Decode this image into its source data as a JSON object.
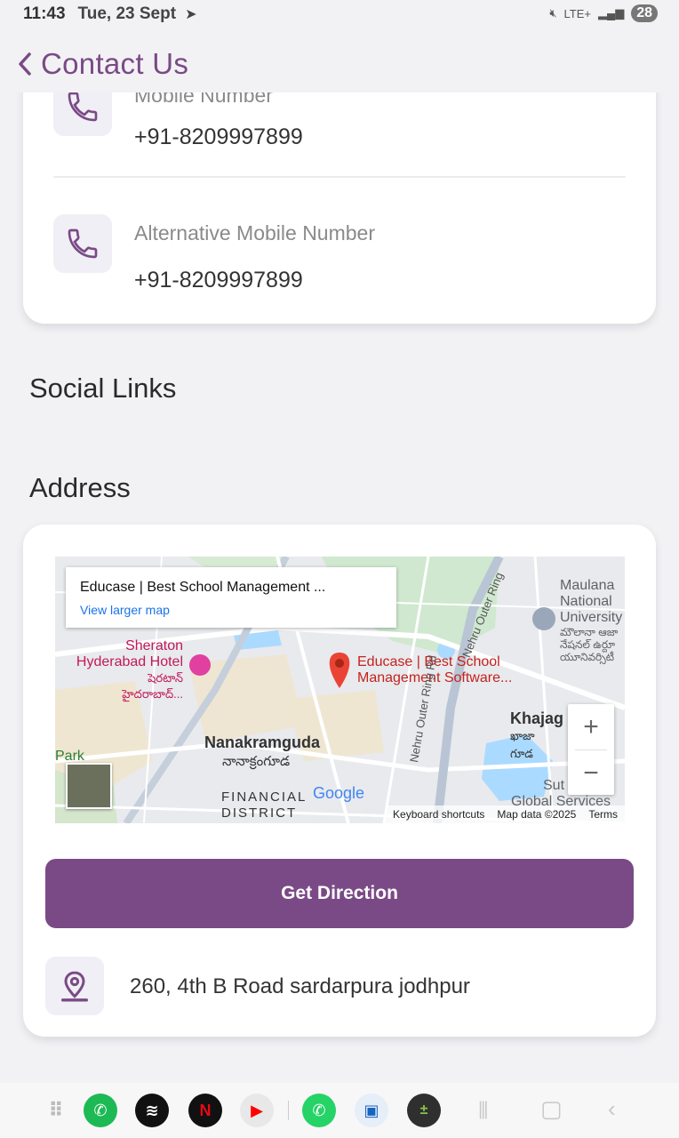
{
  "status_bar": {
    "time": "11:43",
    "date": "Tue, 23 Sept",
    "network": "LTE+",
    "battery": "28"
  },
  "header": {
    "title": "Contact Us"
  },
  "contacts": [
    {
      "label": "Mobile Number",
      "value": "+91-8209997899",
      "icon": "phone-icon"
    },
    {
      "label": "Alternative Mobile Number",
      "value": "+91-8209997899",
      "icon": "phone-icon"
    }
  ],
  "sections": {
    "social_links": "Social Links",
    "address": "Address"
  },
  "map": {
    "info_title": "Educase | Best School Management ...",
    "info_link": "View larger map",
    "pin_label_line1": "Educase | Best School",
    "pin_label_line2": "Management Software...",
    "place_sheraton_1": "Sheraton",
    "place_sheraton_2": "Hyderabad Hotel",
    "place_sheraton_te": "షెరటాన్ హైదరాబాద్...",
    "place_nanakramguda": "Nanakramguda",
    "place_nanakramguda_te": "నానాక్రంగూడ",
    "place_financial_1": "FINANCIAL",
    "place_financial_2": "DISTRICT",
    "place_maulana_1": "Maulana",
    "place_maulana_2": "National",
    "place_maulana_3": "University",
    "place_maulana_te": "మౌలానా ఆజా నేషనల్ ఉర్దూ యూనివర్సిటీ",
    "place_khajaguda": "Khajag",
    "place_khajaguda_te": "ఖాజా గూడ",
    "place_global_1": "Sut",
    "place_global_2": "Global Services",
    "place_park": "Park",
    "road_label": "Nehru Outer Ring Rd",
    "road_label_2": "Nehru Outer Ring",
    "google": "Google",
    "footer_shortcuts": "Keyboard shortcuts",
    "footer_data": "Map data ©2025",
    "footer_terms": "Terms",
    "zoom_in": "+",
    "zoom_out": "−"
  },
  "address_card": {
    "button_label": "Get Direction",
    "address_text": "260, 4th B Road sardarpura jodhpur",
    "icon": "location-pin-icon"
  },
  "colors": {
    "accent": "#7a4a86",
    "icon_bg": "#f0eff5",
    "page_bg": "#f2f2f5"
  },
  "dock": {
    "apps": [
      "grid-icon",
      "phone-app-icon",
      "spotify-icon",
      "netflix-icon",
      "youtube-icon",
      "whatsapp-icon",
      "transit-icon",
      "calculator-icon"
    ],
    "nav": [
      "recents-icon",
      "home-icon",
      "back-icon"
    ]
  }
}
